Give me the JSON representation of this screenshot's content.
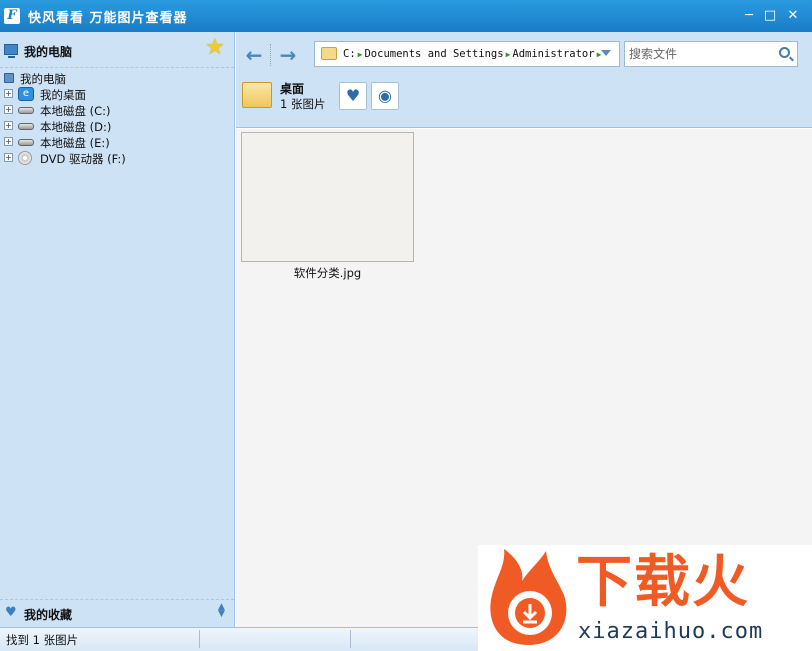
{
  "window": {
    "title": "快风看看 万能图片查看器",
    "logo_letter": "F",
    "minimize_glyph": "─",
    "maximize_glyph": "□",
    "close_glyph": "✕"
  },
  "sidebar": {
    "header_label": "我的电脑",
    "tree": [
      {
        "label": "我的电脑",
        "icon": "computer-icon",
        "expandable": false
      },
      {
        "label": "我的桌面",
        "icon": "desktop-icon",
        "expandable": true
      },
      {
        "label": "本地磁盘 (C:)",
        "icon": "disk-icon",
        "expandable": true
      },
      {
        "label": "本地磁盘 (D:)",
        "icon": "disk-icon",
        "expandable": true
      },
      {
        "label": "本地磁盘 (E:)",
        "icon": "disk-icon",
        "expandable": true
      },
      {
        "label": "DVD 驱动器 (F:)",
        "icon": "dvd-icon",
        "expandable": true
      }
    ],
    "expander_glyph": "+",
    "footer_label": "我的收藏"
  },
  "toolbar": {
    "back_glyph": "←",
    "forward_glyph": "→",
    "path_segments": [
      "C:",
      "Documents and Settings",
      "Administrator"
    ],
    "search_placeholder": "搜索文件",
    "current_folder": {
      "name": "桌面",
      "count_text": "1 张图片"
    },
    "favorite_glyph": "♥",
    "view_glyph": "◉"
  },
  "content": {
    "items": [
      {
        "filename": "软件分类.jpg"
      }
    ]
  },
  "statusbar": {
    "text": "找到 1 张图片"
  },
  "watermark": {
    "brand": "下载火",
    "domain": "xiazaihuo.com",
    "colors": {
      "brand": "#f05a24",
      "domain": "#1e3a5a"
    }
  },
  "colors": {
    "titlebar": "#1a7cc8",
    "panel": "#cde3f5",
    "content_bg": "#f4f4f4"
  }
}
